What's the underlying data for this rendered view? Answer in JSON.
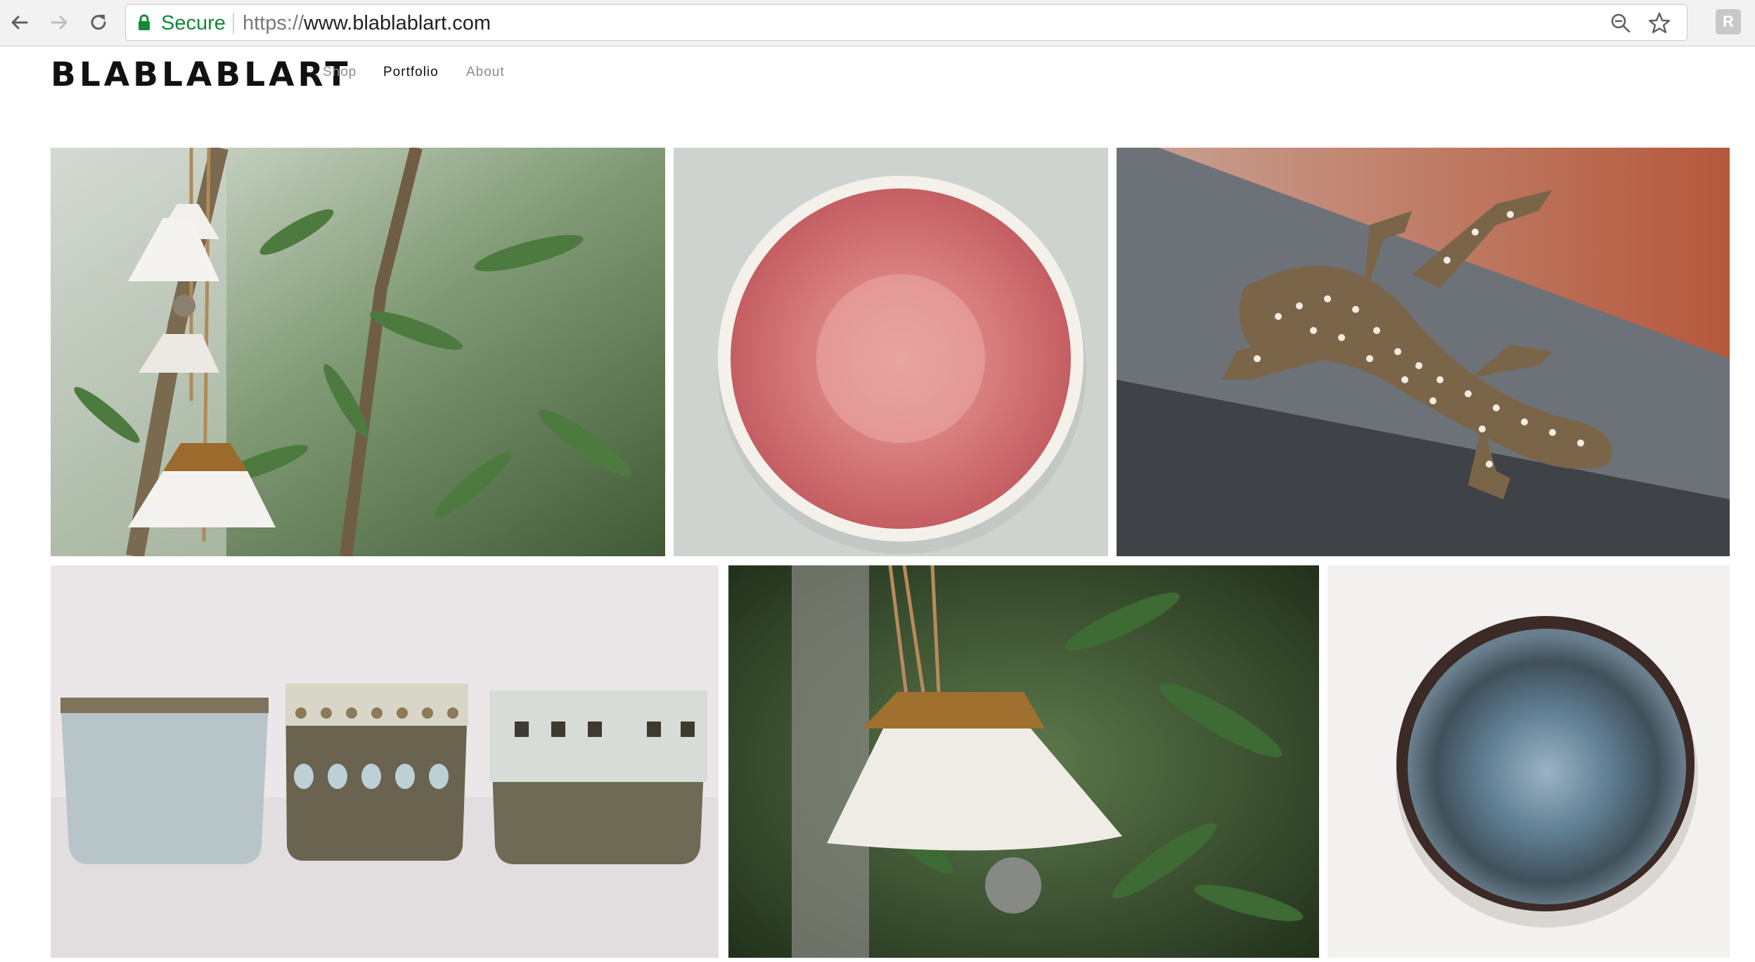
{
  "browser": {
    "secure_label": "Secure",
    "url_scheme": "https://",
    "url_host": "www.blablablart.com",
    "extension_label": "R"
  },
  "site": {
    "logo": "BLABLABLART",
    "nav": [
      {
        "label": "Shop",
        "active": false
      },
      {
        "label": "Portfolio",
        "active": true
      },
      {
        "label": "About",
        "active": false
      }
    ]
  },
  "gallery": {
    "items": [
      {
        "subject": "white ceramic bells hanging in olive tree"
      },
      {
        "subject": "ceramic bowl with pink interior"
      },
      {
        "subject": "speckled ceramic gecko on stone ledge"
      },
      {
        "subject": "three glazed ceramic cups"
      },
      {
        "subject": "white ceramic bell with rust glaze top"
      },
      {
        "subject": "ceramic bowl with blue interior"
      }
    ]
  },
  "colors": {
    "secure_green": "#138a36",
    "nav_active": "#111111",
    "nav_inactive": "#8c8c8c"
  }
}
